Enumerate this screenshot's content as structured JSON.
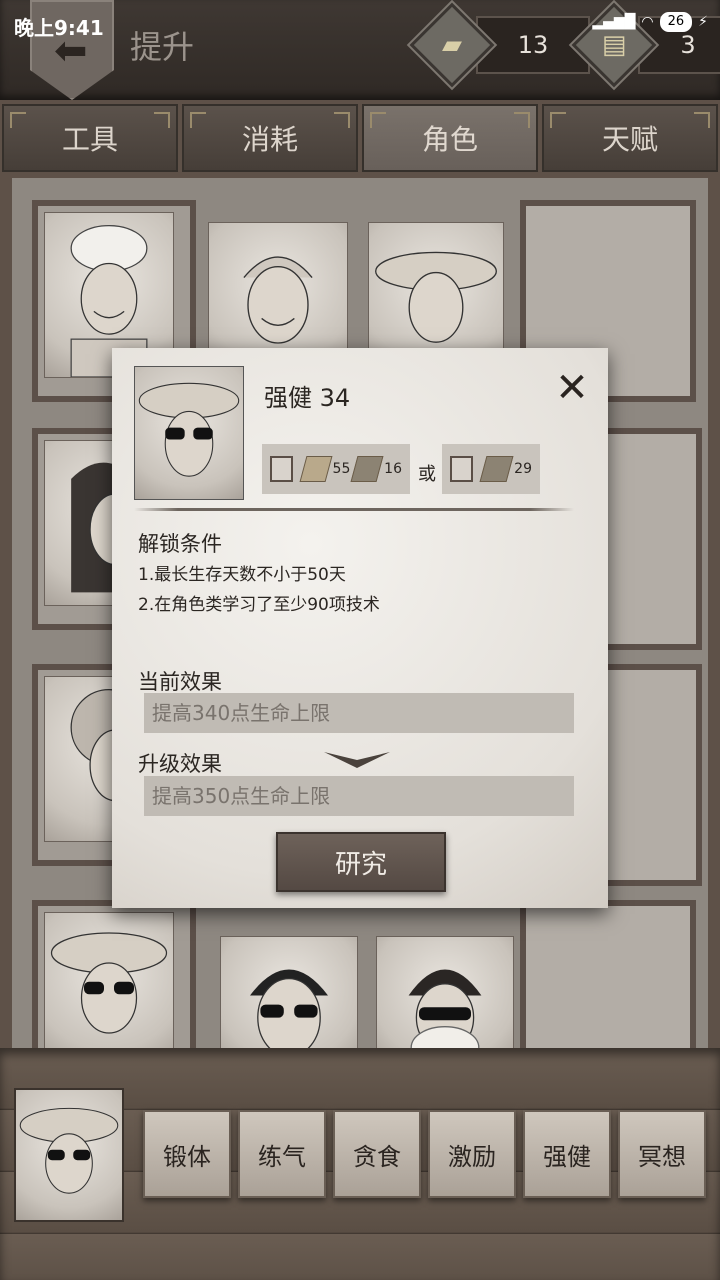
{
  "status": {
    "time": "晚上9:41",
    "battery": "26"
  },
  "header": {
    "title": "提升",
    "currency_a": "13",
    "currency_b": "3"
  },
  "tabs": [
    {
      "label": "工具"
    },
    {
      "label": "消耗"
    },
    {
      "label": "角色",
      "active": true
    },
    {
      "label": "天赋"
    }
  ],
  "popup": {
    "title": "强健 34",
    "cost_option_1": {
      "amount_a": "55",
      "amount_b": "16"
    },
    "or_label": "或",
    "cost_option_2": {
      "amount": "29"
    },
    "unlock_label": "解锁条件",
    "conditions": [
      "1.最长生存天数不小于50天",
      "2.在角色类学习了至少90项技术"
    ],
    "current_label": "当前效果",
    "current_effect": "提高340点生命上限",
    "upgrade_label": "升级效果",
    "upgrade_effect": "提高350点生命上限",
    "research_button": "研究"
  },
  "skills": [
    {
      "label": "锻体"
    },
    {
      "label": "练气"
    },
    {
      "label": "贪食"
    },
    {
      "label": "激励"
    },
    {
      "label": "强健"
    },
    {
      "label": "冥想"
    }
  ]
}
